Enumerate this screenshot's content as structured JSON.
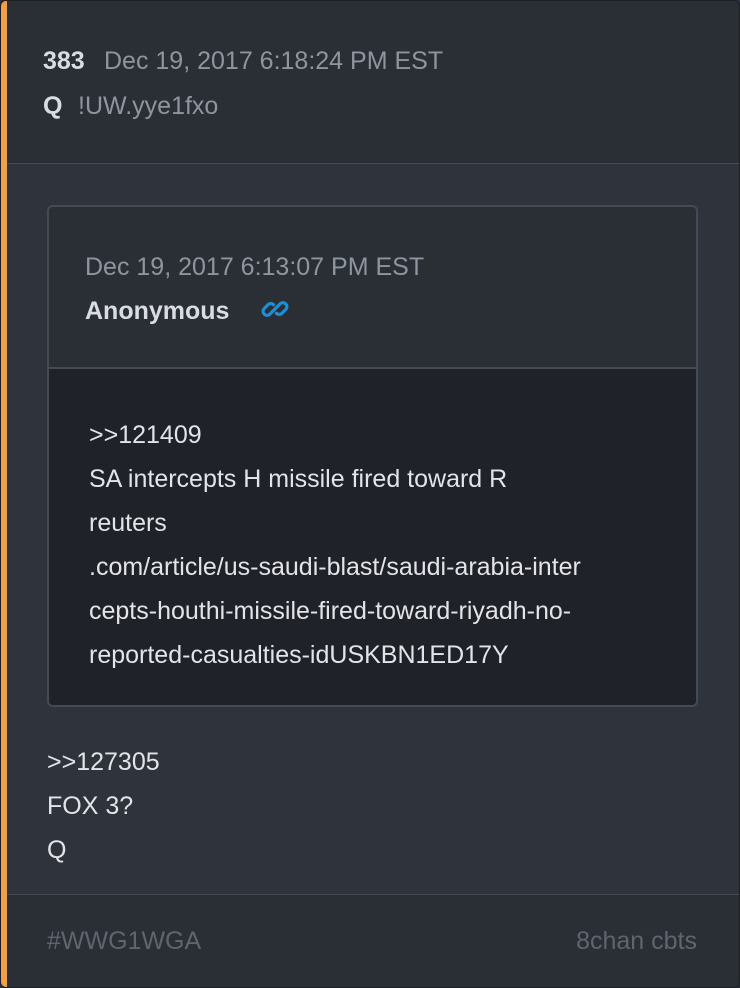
{
  "post": {
    "number": "383",
    "date": "Dec 19, 2017 6:18:24 PM EST",
    "author": "Q",
    "tripcode": "!UW.yye1fxo"
  },
  "quoted_post": {
    "date": "Dec 19, 2017 6:13:07 PM EST",
    "author": "Anonymous",
    "link_icon": "link-icon",
    "lines": [
      ">>121409",
      "SA intercepts H missile fired toward R",
      "reuters",
      ".com/article/us-saudi-blast/saudi-arabia-inter",
      "cepts-houthi-missile-fired-toward-riyadh-no-",
      "reported-casualties-idUSKBN1ED17Y"
    ]
  },
  "reply": {
    "lines": [
      ">>127305",
      "FOX 3?",
      "Q"
    ]
  },
  "footer": {
    "tag": "#WWG1WGA",
    "source": "8chan cbts"
  },
  "colors": {
    "accent": "#f0a04b",
    "link": "#1e8fd6"
  }
}
